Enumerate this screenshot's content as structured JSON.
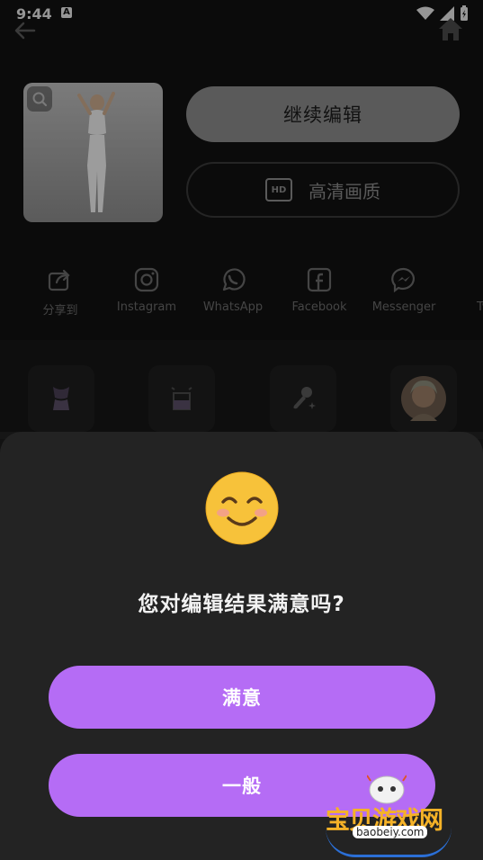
{
  "status_bar": {
    "time": "9:44",
    "notification_badge": "A"
  },
  "top_actions": {
    "continue_edit_label": "继续编辑",
    "hd_badge": "HD",
    "hd_quality_label": "高清画质"
  },
  "share": {
    "items": [
      {
        "label": "分享到",
        "icon": "share-out-icon"
      },
      {
        "label": "Instagram",
        "icon": "instagram-icon"
      },
      {
        "label": "WhatsApp",
        "icon": "whatsapp-icon"
      },
      {
        "label": "Facebook",
        "icon": "facebook-icon"
      },
      {
        "label": "Messenger",
        "icon": "messenger-icon"
      },
      {
        "label": "Tw",
        "icon": "twitter-icon"
      }
    ]
  },
  "tools": [
    "body-shape-icon",
    "cup-sticker-icon",
    "brush-sparkle-icon",
    "face-avatar"
  ],
  "dialog": {
    "emoji": "smiling-face-icon",
    "question": "您对编辑结果满意吗?",
    "satisfied_label": "满意",
    "ok_label": "一般",
    "accent_color": "#b56cf5"
  },
  "watermark": {
    "text": "宝贝游戏网",
    "url": "baobeiy.com"
  }
}
